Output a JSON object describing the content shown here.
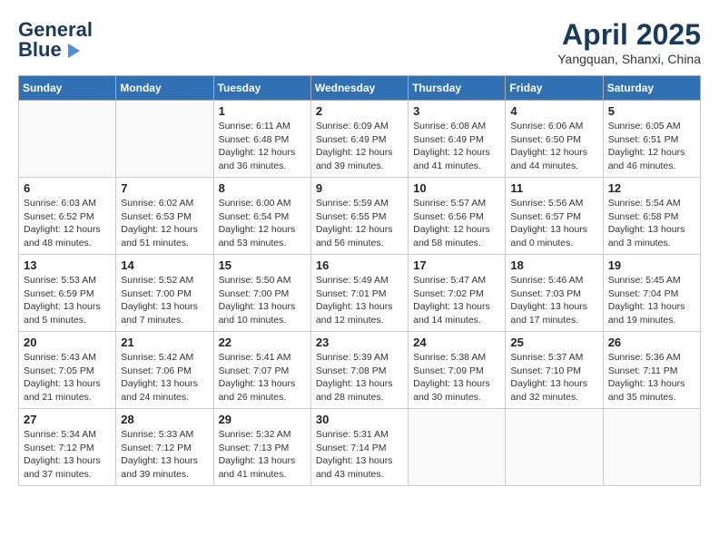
{
  "header": {
    "logo_text1": "General",
    "logo_text2": "Blue",
    "month_title": "April 2025",
    "location": "Yangquan, Shanxi, China"
  },
  "weekdays": [
    "Sunday",
    "Monday",
    "Tuesday",
    "Wednesday",
    "Thursday",
    "Friday",
    "Saturday"
  ],
  "weeks": [
    [
      {
        "day": "",
        "info": ""
      },
      {
        "day": "",
        "info": ""
      },
      {
        "day": "1",
        "info": "Sunrise: 6:11 AM\nSunset: 6:48 PM\nDaylight: 12 hours and 36 minutes."
      },
      {
        "day": "2",
        "info": "Sunrise: 6:09 AM\nSunset: 6:49 PM\nDaylight: 12 hours and 39 minutes."
      },
      {
        "day": "3",
        "info": "Sunrise: 6:08 AM\nSunset: 6:49 PM\nDaylight: 12 hours and 41 minutes."
      },
      {
        "day": "4",
        "info": "Sunrise: 6:06 AM\nSunset: 6:50 PM\nDaylight: 12 hours and 44 minutes."
      },
      {
        "day": "5",
        "info": "Sunrise: 6:05 AM\nSunset: 6:51 PM\nDaylight: 12 hours and 46 minutes."
      }
    ],
    [
      {
        "day": "6",
        "info": "Sunrise: 6:03 AM\nSunset: 6:52 PM\nDaylight: 12 hours and 48 minutes."
      },
      {
        "day": "7",
        "info": "Sunrise: 6:02 AM\nSunset: 6:53 PM\nDaylight: 12 hours and 51 minutes."
      },
      {
        "day": "8",
        "info": "Sunrise: 6:00 AM\nSunset: 6:54 PM\nDaylight: 12 hours and 53 minutes."
      },
      {
        "day": "9",
        "info": "Sunrise: 5:59 AM\nSunset: 6:55 PM\nDaylight: 12 hours and 56 minutes."
      },
      {
        "day": "10",
        "info": "Sunrise: 5:57 AM\nSunset: 6:56 PM\nDaylight: 12 hours and 58 minutes."
      },
      {
        "day": "11",
        "info": "Sunrise: 5:56 AM\nSunset: 6:57 PM\nDaylight: 13 hours and 0 minutes."
      },
      {
        "day": "12",
        "info": "Sunrise: 5:54 AM\nSunset: 6:58 PM\nDaylight: 13 hours and 3 minutes."
      }
    ],
    [
      {
        "day": "13",
        "info": "Sunrise: 5:53 AM\nSunset: 6:59 PM\nDaylight: 13 hours and 5 minutes."
      },
      {
        "day": "14",
        "info": "Sunrise: 5:52 AM\nSunset: 7:00 PM\nDaylight: 13 hours and 7 minutes."
      },
      {
        "day": "15",
        "info": "Sunrise: 5:50 AM\nSunset: 7:00 PM\nDaylight: 13 hours and 10 minutes."
      },
      {
        "day": "16",
        "info": "Sunrise: 5:49 AM\nSunset: 7:01 PM\nDaylight: 13 hours and 12 minutes."
      },
      {
        "day": "17",
        "info": "Sunrise: 5:47 AM\nSunset: 7:02 PM\nDaylight: 13 hours and 14 minutes."
      },
      {
        "day": "18",
        "info": "Sunrise: 5:46 AM\nSunset: 7:03 PM\nDaylight: 13 hours and 17 minutes."
      },
      {
        "day": "19",
        "info": "Sunrise: 5:45 AM\nSunset: 7:04 PM\nDaylight: 13 hours and 19 minutes."
      }
    ],
    [
      {
        "day": "20",
        "info": "Sunrise: 5:43 AM\nSunset: 7:05 PM\nDaylight: 13 hours and 21 minutes."
      },
      {
        "day": "21",
        "info": "Sunrise: 5:42 AM\nSunset: 7:06 PM\nDaylight: 13 hours and 24 minutes."
      },
      {
        "day": "22",
        "info": "Sunrise: 5:41 AM\nSunset: 7:07 PM\nDaylight: 13 hours and 26 minutes."
      },
      {
        "day": "23",
        "info": "Sunrise: 5:39 AM\nSunset: 7:08 PM\nDaylight: 13 hours and 28 minutes."
      },
      {
        "day": "24",
        "info": "Sunrise: 5:38 AM\nSunset: 7:09 PM\nDaylight: 13 hours and 30 minutes."
      },
      {
        "day": "25",
        "info": "Sunrise: 5:37 AM\nSunset: 7:10 PM\nDaylight: 13 hours and 32 minutes."
      },
      {
        "day": "26",
        "info": "Sunrise: 5:36 AM\nSunset: 7:11 PM\nDaylight: 13 hours and 35 minutes."
      }
    ],
    [
      {
        "day": "27",
        "info": "Sunrise: 5:34 AM\nSunset: 7:12 PM\nDaylight: 13 hours and 37 minutes."
      },
      {
        "day": "28",
        "info": "Sunrise: 5:33 AM\nSunset: 7:12 PM\nDaylight: 13 hours and 39 minutes."
      },
      {
        "day": "29",
        "info": "Sunrise: 5:32 AM\nSunset: 7:13 PM\nDaylight: 13 hours and 41 minutes."
      },
      {
        "day": "30",
        "info": "Sunrise: 5:31 AM\nSunset: 7:14 PM\nDaylight: 13 hours and 43 minutes."
      },
      {
        "day": "",
        "info": ""
      },
      {
        "day": "",
        "info": ""
      },
      {
        "day": "",
        "info": ""
      }
    ]
  ]
}
